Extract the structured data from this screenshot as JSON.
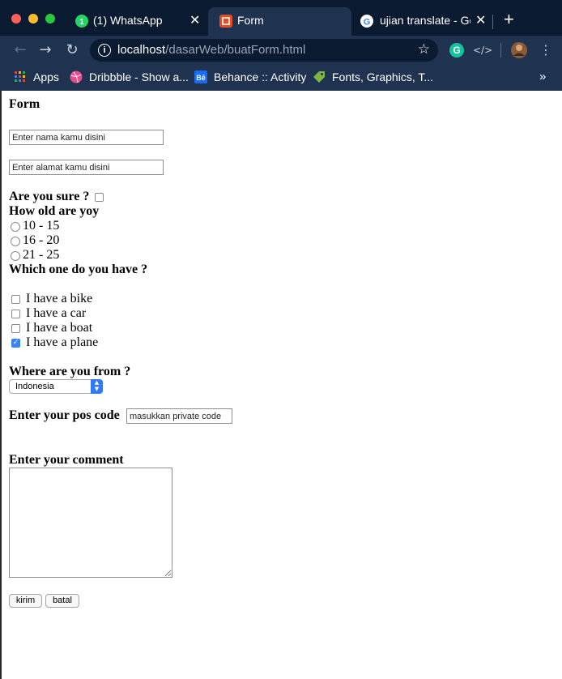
{
  "browser": {
    "tabs": [
      {
        "title": "(1) WhatsApp",
        "icon": "whatsapp-icon",
        "active": false
      },
      {
        "title": "Form",
        "icon": "html5-icon",
        "active": true
      },
      {
        "title": "ujian translate - Goo",
        "icon": "google-icon",
        "active": false
      }
    ],
    "new_tab_label": "+",
    "url": {
      "host": "localhost",
      "path": "/dasarWeb/buatForm.html"
    },
    "bookmarks": [
      {
        "label": "Apps",
        "icon": "apps-grid-icon"
      },
      {
        "label": "Dribbble - Show a...",
        "icon": "dribbble-icon"
      },
      {
        "label": "Behance :: Activity",
        "icon": "behance-icon"
      },
      {
        "label": "Fonts, Graphics, T...",
        "icon": "tag-icon"
      }
    ],
    "more_bookmarks": "»"
  },
  "form": {
    "title": "Form",
    "name_placeholder": "Enter nama kamu disini",
    "address_placeholder": "Enter alamat kamu disini",
    "sure_label": "Are you sure ?",
    "age_label": "How old are yoy",
    "age_options": [
      "10 - 15",
      "16 - 20",
      "21 - 25"
    ],
    "have_label": "Which one do you have ?",
    "have_options": [
      {
        "label": "I have a bike",
        "checked": false
      },
      {
        "label": "I have a car",
        "checked": false
      },
      {
        "label": "I have a boat",
        "checked": false
      },
      {
        "label": "I have a plane",
        "checked": true
      }
    ],
    "from_label": "Where are you from ?",
    "country_selected": "Indonesia",
    "pos_label": "Enter your pos code",
    "pos_placeholder": "masukkan private code",
    "comment_label": "Enter your comment",
    "submit_label": "kirim",
    "cancel_label": "batal"
  },
  "colors": {
    "tab_strip": "#0a1a30",
    "toolbar": "#1f3350",
    "checkbox_checked": "#3b82f6",
    "select_arrow": "#3478f6"
  }
}
